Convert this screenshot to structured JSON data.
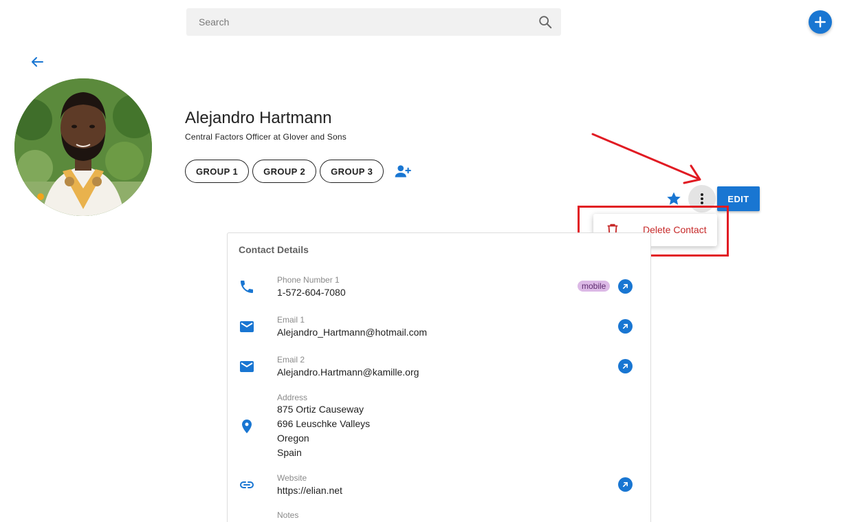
{
  "search": {
    "placeholder": "Search"
  },
  "contact": {
    "name": "Alejandro Hartmann",
    "job": "Central Factors Officer at Glover and Sons",
    "groups": [
      "GROUP 1",
      "GROUP 2",
      "GROUP 3"
    ]
  },
  "actions": {
    "edit_label": "EDIT"
  },
  "menu": {
    "delete_label": "Delete Contact"
  },
  "details": {
    "title": "Contact Details",
    "phone": {
      "label": "Phone Number 1",
      "value": "1-572-604-7080",
      "type": "mobile"
    },
    "email1": {
      "label": "Email 1",
      "value": "Alejandro_Hartmann@hotmail.com"
    },
    "email2": {
      "label": "Email 2",
      "value": "Alejandro.Hartmann@kamille.org"
    },
    "address": {
      "label": "Address",
      "lines": [
        "875 Ortiz Causeway",
        "696 Leuschke Valleys",
        "Oregon",
        "Spain"
      ]
    },
    "website": {
      "label": "Website",
      "value": "https://elian.net"
    },
    "notes": {
      "label": "Notes"
    }
  },
  "icons": {
    "search": "search-icon",
    "add": "plus-icon",
    "back": "arrow-left-icon",
    "add_group": "person-add-icon",
    "star": "star-icon",
    "more": "more-vertical-icon",
    "trash": "trash-icon",
    "phone": "phone-icon",
    "email": "email-icon",
    "location": "location-pin-icon",
    "link": "link-icon",
    "open": "open-external-icon"
  },
  "colors": {
    "accent": "#1976d2",
    "danger": "#c62828",
    "annotation": "#e11b23",
    "chip_mobile": "#dcb9e6"
  }
}
